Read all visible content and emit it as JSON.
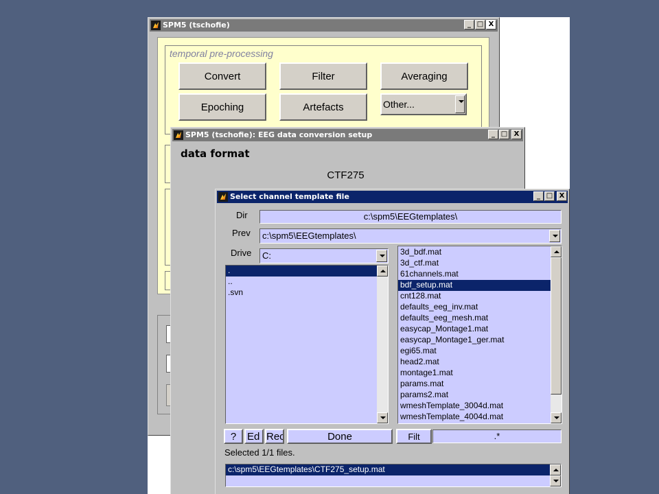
{
  "main_window": {
    "title": "SPM5 (tschofie)",
    "section_title": "temporal pre-processing",
    "buttons": [
      "Convert",
      "Filter",
      "Averaging",
      "Epoching",
      "Artefacts"
    ],
    "other_dropdown": "Other...",
    "controls": [
      "_",
      "□",
      "X"
    ]
  },
  "conversion_window": {
    "title": "SPM5 (tschofie): EEG data conversion setup",
    "heading": "data format",
    "format_value": "CTF275",
    "controls": [
      "_",
      "□",
      "X"
    ]
  },
  "file_dialog": {
    "title": "Select channel template file",
    "controls": [
      "_",
      "□",
      "X"
    ],
    "dir_label": "Dir",
    "dir_value": "c:\\spm5\\EEGtemplates\\",
    "prev_label": "Prev",
    "prev_value": "c:\\spm5\\EEGtemplates\\",
    "drive_label": "Drive",
    "drive_value": "C:",
    "folders": [
      ".",
      "..",
      ".svn"
    ],
    "folder_selected_index": 0,
    "files": [
      "3d_bdf.mat",
      "3d_ctf.mat",
      "61channels.mat",
      "bdf_setup.mat",
      "cnt128.mat",
      "defaults_eeg_inv.mat",
      "defaults_eeg_mesh.mat",
      "easycap_Montage1.mat",
      "easycap_Montage1_ger.mat",
      "egi65.mat",
      "head2.mat",
      "montage1.mat",
      "params.mat",
      "params2.mat",
      "wmeshTemplate_3004d.mat",
      "wmeshTemplate_4004d.mat"
    ],
    "file_selected_index": 3,
    "help_button": "?",
    "edit_button": "Ed",
    "rec_button": "Rec",
    "done_button": "Done",
    "filt_button": "Filt",
    "filter_value": ".*",
    "status_text": "Selected 1/1 files.",
    "selected_files": [
      "c:\\spm5\\EEGtemplates\\CTF275_setup.mat"
    ]
  },
  "colors": {
    "desktop": "#50607e",
    "window_face": "#c0c0c0",
    "panel_yellow": "#ffffcc",
    "field_lavender": "#ccccff",
    "selection_navy": "#0b246a"
  }
}
